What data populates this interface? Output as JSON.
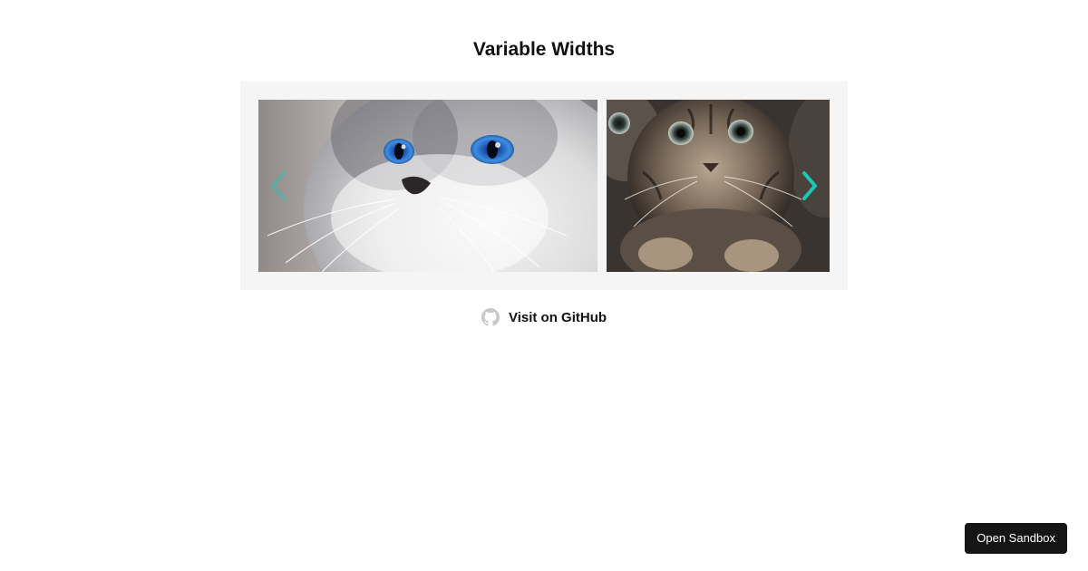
{
  "page": {
    "title": "Variable Widths"
  },
  "carousel": {
    "slides": [
      {
        "image": "white-cat-blue-eyes-photo"
      },
      {
        "image": "tabby-kitten-photo"
      }
    ],
    "prev_icon": "chevron-left-icon",
    "next_icon": "chevron-right-icon",
    "arrow_color": "#1cc7b7",
    "background_color": "#f5f5f5"
  },
  "github_link": {
    "label": "Visit on GitHub",
    "icon": "github-icon"
  },
  "sandbox_button": {
    "label": "Open Sandbox"
  }
}
